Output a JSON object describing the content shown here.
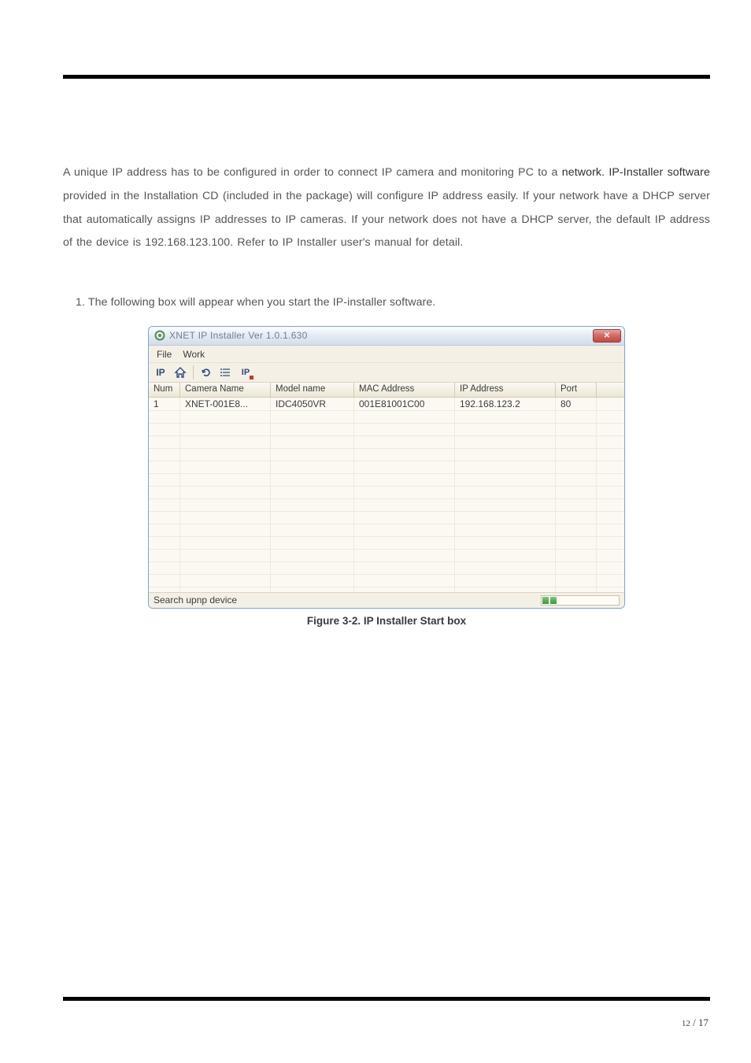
{
  "intro_text_plain": "A unique IP address has to be configured in order to connect IP camera and monitoring PC to a ",
  "intro_text_dark": "network. IP-Installer software",
  "intro_text_rest": " provided in the Installation CD (included in the package) will configure IP address easily. If your network have a DHCP server that automatically assigns IP addresses to IP cameras. If your network does not have a DHCP server, the default IP address of the device is 192.168.123.100. Refer to IP Installer user's manual for detail.",
  "step_text": "1. The following box will appear when you start the IP-installer software.",
  "window": {
    "title": "XNET IP Installer Ver 1.0.1.630",
    "close_label": "✕",
    "menu": {
      "file": "File",
      "work": "Work"
    },
    "toolbar": {
      "ip_label": "IP",
      "icons": [
        "home-icon",
        "refresh-icon",
        "list-icon",
        "ip-device-icon"
      ]
    },
    "columns": [
      "Num",
      "Camera Name",
      "Model name",
      "MAC Address",
      "IP Address",
      "Port"
    ],
    "rows": [
      {
        "num": "1",
        "camera": "XNET-001E8...",
        "model": "IDC4050VR",
        "mac": "001E81001C00",
        "ip": "192.168.123.2",
        "port": "80"
      }
    ],
    "status": "Search upnp device"
  },
  "caption": "Figure 3-2. IP Installer Start box",
  "page": {
    "cur": "12",
    "total": "17"
  }
}
